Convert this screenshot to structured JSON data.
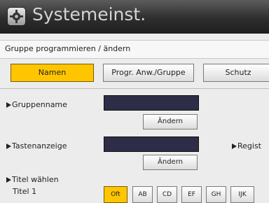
{
  "window": {
    "title": "Systemeinst.",
    "icon": "gear-icon"
  },
  "breadcrumb": "Gruppe programmieren / ändern",
  "tabs": [
    {
      "label": "Namen",
      "active": true
    },
    {
      "label": "Progr. Anw./Gruppe",
      "active": false
    },
    {
      "label": "Schutz",
      "active": false
    }
  ],
  "form": {
    "group_name": {
      "label": "Gruppenname",
      "value": "",
      "change_button": "Ändern"
    },
    "key_display": {
      "label": "Tastenanzeige",
      "value": "",
      "change_button": "Ändern"
    },
    "register_label": "Regist",
    "title_select": {
      "label": "Titel wählen",
      "row_label": "Titel 1"
    }
  },
  "title_options": [
    {
      "label": "Oft",
      "active": true
    },
    {
      "label": "AB",
      "active": false
    },
    {
      "label": "CD",
      "active": false
    },
    {
      "label": "EF",
      "active": false
    },
    {
      "label": "GH",
      "active": false
    },
    {
      "label": "IJK",
      "active": false
    }
  ],
  "colors": {
    "accent": "#ffc600",
    "field": "#2d2d47",
    "titlebar": "#2e2e2e"
  }
}
